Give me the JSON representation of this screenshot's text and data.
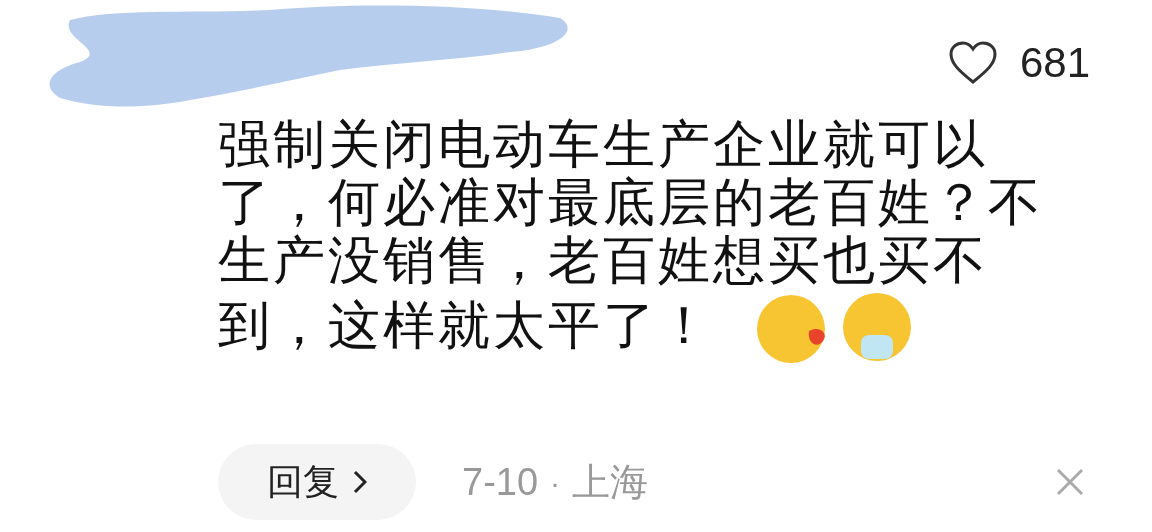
{
  "comment": {
    "liked": false,
    "like_count": "681",
    "text_lines": [
      "强制关闭电动车生产企业就可以",
      "了，何必准对最底层的老百姓？不",
      "生产没销售，老百姓想买也买不",
      "到，这样就太平了！"
    ],
    "reply_button": "回复",
    "date": "7-10",
    "separator": "·",
    "location": "上海"
  }
}
